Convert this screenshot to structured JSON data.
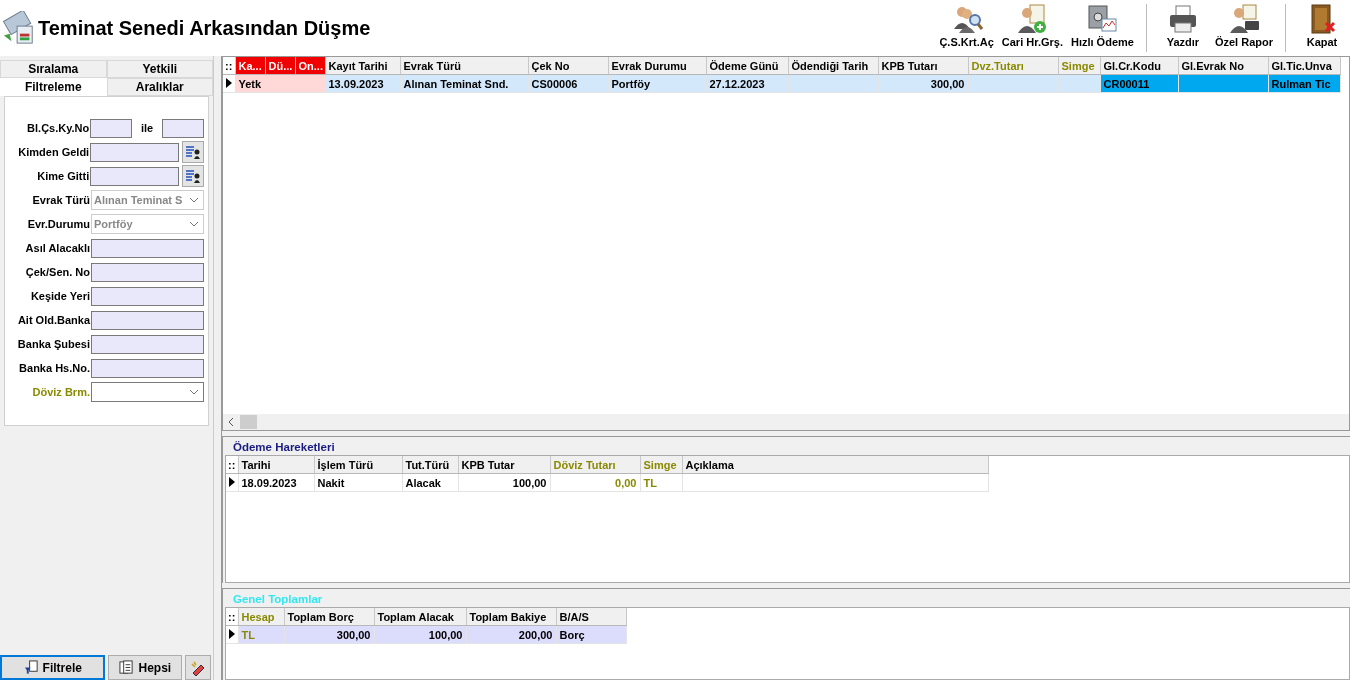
{
  "window": {
    "title": "Teminat Senedi Arkasından Düşme"
  },
  "toolbar_groups": [
    {
      "buttons": [
        {
          "kind": "search",
          "label": "Ç.S.Krt.Aç"
        },
        {
          "kind": "add",
          "label": "Cari Hr.Grş."
        },
        {
          "kind": "safe",
          "label": "Hızlı Ödeme"
        }
      ]
    },
    {
      "buttons": [
        {
          "kind": "print",
          "label": "Yazdır"
        },
        {
          "kind": "report",
          "label": "Özel Rapor"
        }
      ]
    },
    {
      "buttons": [
        {
          "kind": "exit",
          "label": "Kapat"
        }
      ]
    }
  ],
  "side_tabs": [
    [
      {
        "label": "Sıralama",
        "selected": false
      },
      {
        "label": "Yetkili",
        "selected": false
      }
    ],
    [
      {
        "label": "Filtreleme",
        "selected": true
      },
      {
        "label": "Aralıklar",
        "selected": false
      }
    ]
  ],
  "filters": [
    {
      "kind": "range",
      "label": "Bl.Çs.Ky.No",
      "joiner": "ile"
    },
    {
      "kind": "lookup",
      "label": "Kimden Geldi"
    },
    {
      "kind": "lookup",
      "label": "Kime Gitti"
    },
    {
      "kind": "combo",
      "label": "Evrak Türü",
      "value": "Alınan Teminat S",
      "disabled": true
    },
    {
      "kind": "combo",
      "label": "Evr.Durumu",
      "value": "Portföy",
      "disabled": true
    },
    {
      "kind": "text",
      "label": "Asıl Alacaklı"
    },
    {
      "kind": "text",
      "label": "Çek/Sen. No"
    },
    {
      "kind": "text",
      "label": "Keşide Yeri"
    },
    {
      "kind": "text",
      "label": "Ait Old.Banka"
    },
    {
      "kind": "text",
      "label": "Banka Şubesi"
    },
    {
      "kind": "text",
      "label": "Banka Hs.No."
    },
    {
      "kind": "currency",
      "label": "Döviz Brm.",
      "disabled": false
    }
  ],
  "side_buttons": [
    {
      "kind": "filter",
      "label": "Filtrele",
      "focused": true
    },
    {
      "kind": "all",
      "label": "Hepsi",
      "focused": false
    },
    {
      "kind": "clear",
      "focused": false
    }
  ],
  "main_table": {
    "columns": [
      {
        "label": "Ka...",
        "kind": "flag"
      },
      {
        "label": "Dü...",
        "kind": "flag"
      },
      {
        "label": "On...",
        "kind": "flag"
      },
      {
        "label": "Kayıt Tarihi",
        "kind": "plain"
      },
      {
        "label": "Evrak Türü",
        "kind": "plain"
      },
      {
        "label": "Çek No",
        "kind": "plain"
      },
      {
        "label": "Evrak Durumu",
        "kind": "plain"
      },
      {
        "label": "Ödeme Günü",
        "kind": "plain"
      },
      {
        "label": "Ödendiği Tarih",
        "kind": "plain"
      },
      {
        "label": "KPB Tutarı",
        "kind": "amount"
      },
      {
        "label": "Dvz.Tutarı",
        "kind": "currency"
      },
      {
        "label": "Simge",
        "kind": "currency"
      },
      {
        "label": "Gl.Cr.Kodu",
        "kind": "linked"
      },
      {
        "label": "Gl.Evrak No",
        "kind": "linked"
      },
      {
        "label": "Gl.Tic.Unva",
        "kind": "linked"
      }
    ],
    "corner": "::",
    "rows": [
      {
        "selected": true,
        "cells": [
          "Yetk",
          "",
          "",
          "13.09.2023",
          "Alınan Teminat Snd.",
          "CS00006",
          "Portföy",
          "27.12.2023",
          "",
          "300,00",
          "",
          "",
          "CR00011",
          "",
          "Rulman Tic"
        ]
      }
    ]
  },
  "payments": {
    "title": "Ödeme Hareketleri",
    "corner": "::",
    "columns": [
      {
        "label": "Tarihi",
        "kind": "plain"
      },
      {
        "label": "İşlem Türü",
        "kind": "plain"
      },
      {
        "label": "Tut.Türü",
        "kind": "plain"
      },
      {
        "label": "KPB Tutar",
        "kind": "amount"
      },
      {
        "label": "Döviz Tutarı",
        "kind": "currency-amount"
      },
      {
        "label": "Simge",
        "kind": "currency"
      },
      {
        "label": "Açıklama",
        "kind": "plain"
      }
    ],
    "rows": [
      {
        "selected": true,
        "cells": [
          "18.09.2023",
          "Nakit",
          "Alacak",
          "100,00",
          "0,00",
          "TL",
          ""
        ]
      }
    ]
  },
  "totals": {
    "title": "Genel Toplamlar",
    "corner": "::",
    "columns": [
      {
        "label": "Hesap",
        "kind": "currency"
      },
      {
        "label": "Toplam Borç",
        "kind": "amount"
      },
      {
        "label": "Toplam Alacak",
        "kind": "amount"
      },
      {
        "label": "Toplam Bakiye",
        "kind": "amount"
      },
      {
        "label": "B/A/S",
        "kind": "plain"
      }
    ],
    "rows": [
      {
        "selected": true,
        "cells": [
          "TL",
          "300,00",
          "100,00",
          "200,00",
          "Borç"
        ]
      }
    ]
  }
}
